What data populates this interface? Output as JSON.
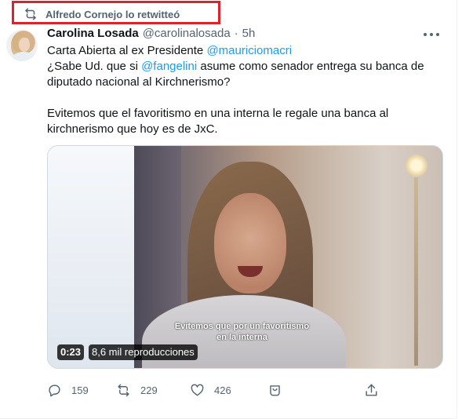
{
  "retweet": {
    "text": "Alfredo Cornejo lo retwitteó"
  },
  "tweet": {
    "author_name": "Carolina Losada",
    "author_handle": "@carolinalosada",
    "separator": "·",
    "time": "5h",
    "lines": {
      "line1_prefix": "Carta Abierta al ex Presidente ",
      "line1_mention": "@mauriciomacri",
      "line2_prefix": "¿Sabe Ud. que si ",
      "line2_mention": "@fangelini",
      "line2_suffix": " asume como senador entrega su banca de",
      "line3": "diputado nacional al Kirchnerismo?",
      "line4": "Evitemos que el favoritismo en una interna le regale una banca al",
      "line5": "kirchnerismo que hoy es de JxC."
    }
  },
  "video": {
    "subtitle_line1": "Evitemos que por un favoritismo",
    "subtitle_line2": "en la interna",
    "duration": "0:23",
    "views": "8,6 mil reproducciones"
  },
  "actions": {
    "replies": "159",
    "retweets": "229",
    "likes": "426"
  }
}
